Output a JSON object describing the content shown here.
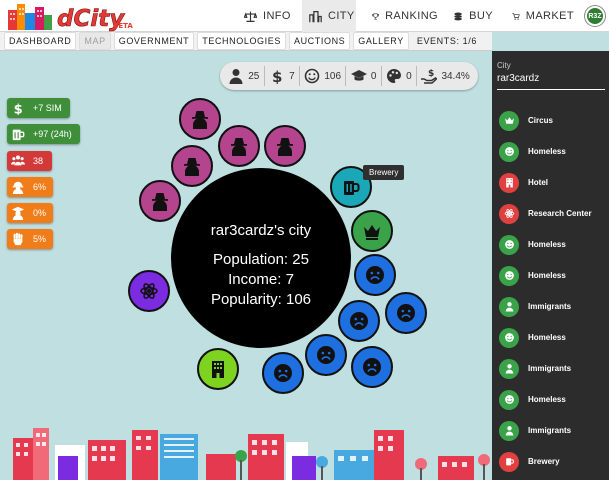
{
  "app": {
    "logo_text": "dCity",
    "logo_badge": "BETA"
  },
  "nav": [
    {
      "label": "INFO",
      "icon": "scale-icon",
      "active": false
    },
    {
      "label": "CITY",
      "icon": "city-icon",
      "active": true
    },
    {
      "label": "RANKING",
      "icon": "trophy-icon",
      "active": false
    },
    {
      "label": "BUY",
      "icon": "coins-icon",
      "active": false
    },
    {
      "label": "MARKET",
      "icon": "cart-icon",
      "active": false
    }
  ],
  "user": {
    "avatar_text": "R3Z"
  },
  "subnav": [
    "DASHBOARD",
    "MAP",
    "GOVERNMENT",
    "TECHNOLOGIES",
    "AUCTIONS",
    "GALLERY",
    "EVENTS: 1/6"
  ],
  "subnav_active": "MAP",
  "stats": {
    "population": "25",
    "income": "7",
    "popularity": "106",
    "education": "0",
    "creativity": "0",
    "tax": "34.4%"
  },
  "badges": [
    {
      "text": "+7 SIM",
      "icon": "dollar-icon",
      "color": "#3f8f3a"
    },
    {
      "text": "+97 (24h)",
      "icon": "beer-icon",
      "color": "#3f8f3a"
    },
    {
      "text": "38",
      "icon": "people-icon",
      "color": "#d23a3a"
    },
    {
      "text": "6%",
      "icon": "worker-icon",
      "color": "#f07d1a"
    },
    {
      "text": "0%",
      "icon": "graduate-icon",
      "color": "#f07d1a"
    },
    {
      "text": "5%",
      "icon": "fist-icon",
      "color": "#f07d1a"
    }
  ],
  "city": {
    "title": "rar3cardz's city",
    "population": "Population: 25",
    "income": "Income: 7",
    "popularity": "Popularity: 106"
  },
  "tooltip": "Brewery",
  "sidebar": {
    "city_label": "City",
    "city_value": "rar3cardz",
    "items": [
      {
        "label": "Circus",
        "icon": "crown-icon",
        "color": "#3aa34a"
      },
      {
        "label": "Homeless",
        "icon": "smile-icon",
        "color": "#3aa34a"
      },
      {
        "label": "Hotel",
        "icon": "hotel-icon",
        "color": "#e04040"
      },
      {
        "label": "Research Center",
        "icon": "atom-icon",
        "color": "#e04040"
      },
      {
        "label": "Homeless",
        "icon": "smile-icon",
        "color": "#3aa34a"
      },
      {
        "label": "Homeless",
        "icon": "smile-icon",
        "color": "#3aa34a"
      },
      {
        "label": "Immigrants",
        "icon": "person-icon",
        "color": "#3aa34a"
      },
      {
        "label": "Homeless",
        "icon": "smile-icon",
        "color": "#3aa34a"
      },
      {
        "label": "Immigrants",
        "icon": "person-icon",
        "color": "#3aa34a"
      },
      {
        "label": "Homeless",
        "icon": "smile-icon",
        "color": "#3aa34a"
      },
      {
        "label": "Immigrants",
        "icon": "person-icon",
        "color": "#3aa34a"
      },
      {
        "label": "Brewery",
        "icon": "beer-icon",
        "color": "#e04040"
      }
    ]
  }
}
